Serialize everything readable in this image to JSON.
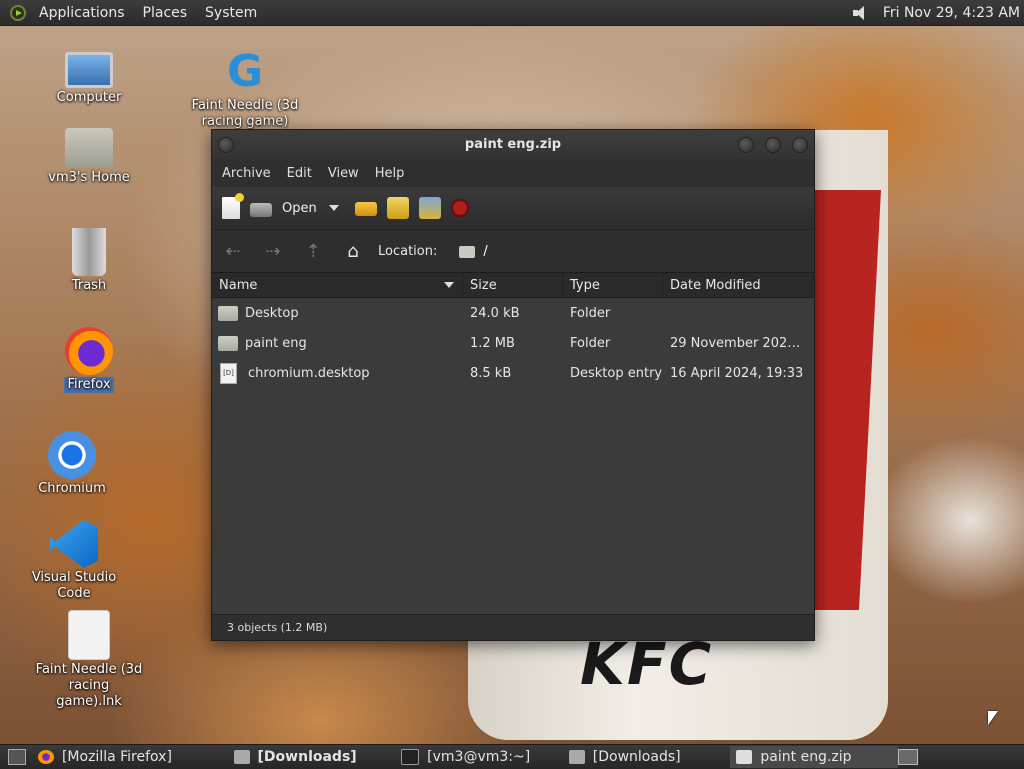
{
  "panel": {
    "menus": [
      "Applications",
      "Places",
      "System"
    ],
    "clock": "Fri Nov 29,  4:23 AM"
  },
  "desktop": {
    "icons": [
      {
        "label": "Computer",
        "icon": "computer-icon"
      },
      {
        "label": "Faint Needle (3d racing game)",
        "icon": "faint-needle-icon"
      },
      {
        "label": "vm3's Home",
        "icon": "home-folder-icon"
      },
      {
        "label": "Trash",
        "icon": "trash-icon"
      },
      {
        "label": "Firefox",
        "icon": "firefox-icon"
      },
      {
        "label": "Chromium",
        "icon": "chromium-icon"
      },
      {
        "label": "Visual Studio Code",
        "icon": "vscode-icon"
      },
      {
        "label": "Faint Needle (3d racing game).lnk",
        "icon": "link-file-icon"
      }
    ],
    "wallpaper_text": "KFC"
  },
  "window": {
    "title": "paint eng.zip",
    "menu": [
      "Archive",
      "Edit",
      "View",
      "Help"
    ],
    "toolbar": {
      "open_label": "Open"
    },
    "location": {
      "label": "Location:",
      "path": "/"
    },
    "columns": [
      "Name",
      "Size",
      "Type",
      "Date Modified"
    ],
    "rows": [
      {
        "name": "Desktop",
        "size": "24.0 kB",
        "type": "Folder",
        "date": "",
        "icon": "folder-icon"
      },
      {
        "name": "paint eng",
        "size": "1.2 MB",
        "type": "Folder",
        "date": "29 November 2024, …",
        "icon": "folder-icon"
      },
      {
        "name": "chromium.desktop",
        "size": "8.5 kB",
        "type": "Desktop entry",
        "date": "16 April 2024, 19:33",
        "icon": "file-icon"
      }
    ],
    "status": "3 objects (1.2 MB)"
  },
  "taskbar": {
    "tasks": [
      {
        "label": "[Mozilla Firefox]",
        "bold": false
      },
      {
        "label": "[Downloads]",
        "bold": true
      },
      {
        "label": "[vm3@vm3:~]",
        "bold": false
      },
      {
        "label": "[Downloads]",
        "bold": false
      },
      {
        "label": "paint eng.zip",
        "bold": false
      }
    ]
  },
  "colors": {
    "panel_bg": "#2b2b2b",
    "window_bg": "#3b3b3b",
    "selection": "#4a6fa5",
    "stop_red": "#b21e1e"
  }
}
